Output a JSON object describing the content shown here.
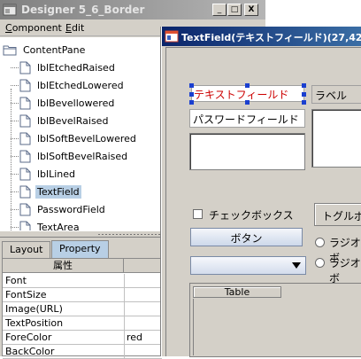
{
  "designer": {
    "title": "Designer 5_6_Border",
    "window_buttons": {
      "minimize": "_",
      "maximize": "□",
      "close": "X"
    },
    "menu": [
      {
        "label": "Component",
        "underline": "C"
      },
      {
        "label": "Edit",
        "underline": "E"
      }
    ],
    "tree": {
      "root": "ContentPane",
      "items": [
        "lblEtchedRaised",
        "lblEtchedLowered",
        "lblBevellowered",
        "lblBevelRaised",
        "lblSoftBevelLowered",
        "lblSoftBevelRaised",
        "lblLined",
        "TextField",
        "PasswordField",
        "TextArea"
      ],
      "selected_index": 7
    },
    "tabs": [
      "Layout",
      "Property"
    ],
    "active_tab": "Property",
    "property_table": {
      "header": "属性",
      "rows": [
        {
          "name": "Font",
          "value": ""
        },
        {
          "name": "FontSize",
          "value": ""
        },
        {
          "name": "Image(URL)",
          "value": ""
        },
        {
          "name": "TextPosition",
          "value": ""
        },
        {
          "name": "ForeColor",
          "value": "red"
        },
        {
          "name": "BackColor",
          "value": ""
        }
      ]
    }
  },
  "editor": {
    "title": "TextField(テキストフィールド)(27,42,13",
    "widgets": {
      "text_field": "テキストフィールド",
      "label": "ラベル",
      "password_field": "パスワードフィールド",
      "checkbox": "チェックボックス",
      "toggle_button": "トグルボ",
      "button": "ボタン",
      "radio1": "ラジオボ",
      "radio2": "ラジオボ",
      "table_header": "Table"
    },
    "colors": {
      "text_field_fore": "#cc0000",
      "selection": "#1a3fd0"
    }
  }
}
